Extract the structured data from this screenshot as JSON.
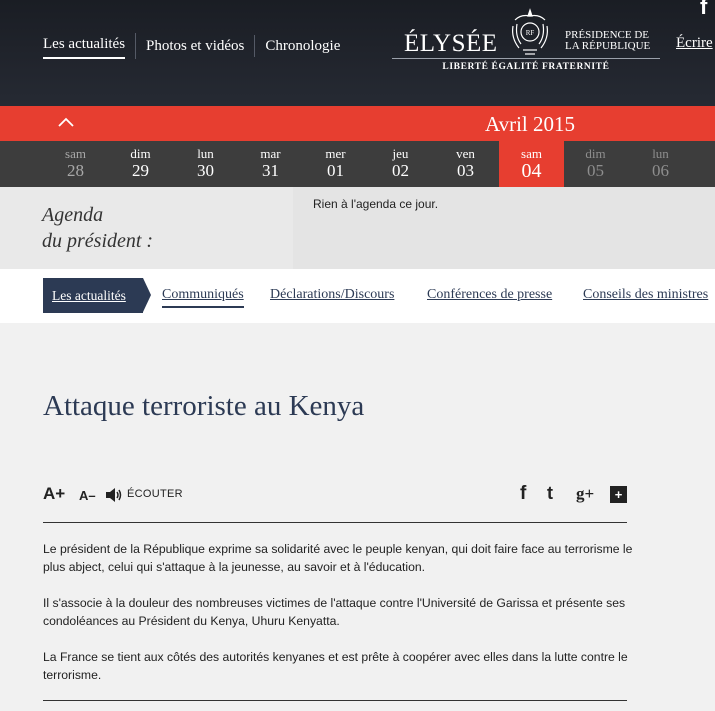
{
  "header": {
    "nav": [
      "Les actualités",
      "Photos et vidéos",
      "Chronologie"
    ],
    "active_nav": "Les actualités",
    "logo_name": "ÉLYSÉE",
    "logo_presidence_line1": "PRÉSIDENCE DE",
    "logo_presidence_line2": "LA RÉPUBLIQUE",
    "logo_motto": "LIBERTÉ ÉGALITÉ FRATERNITÉ",
    "ecrire": "Écrire",
    "facebook_glyph": "f"
  },
  "calendar": {
    "month": "Avril 2015",
    "days": [
      {
        "name": "sam",
        "num": "28"
      },
      {
        "name": "dim",
        "num": "29"
      },
      {
        "name": "lun",
        "num": "30"
      },
      {
        "name": "mar",
        "num": "31"
      },
      {
        "name": "mer",
        "num": "01"
      },
      {
        "name": "jeu",
        "num": "02"
      },
      {
        "name": "ven",
        "num": "03"
      },
      {
        "name": "sam",
        "num": "04"
      },
      {
        "name": "dim",
        "num": "05"
      },
      {
        "name": "lun",
        "num": "06"
      }
    ]
  },
  "agenda": {
    "title_line1": "Agenda",
    "title_line2": "du président :",
    "empty_text": "Rien à l'agenda ce jour."
  },
  "subnav": {
    "active": "Les actualités",
    "links": [
      "Communiqués",
      "Déclarations/Discours",
      "Conférences de presse",
      "Conseils des ministres"
    ]
  },
  "article": {
    "title": "Attaque terroriste au Kenya",
    "tools": {
      "aplus": "A+",
      "aminus": "A–",
      "listen": "ÉCOUTER"
    },
    "social": {
      "facebook": "f",
      "twitter": "t",
      "googleplus": "g+",
      "more": "+"
    },
    "paragraphs": [
      "Le président de la République exprime sa solidarité avec le peuple kenyan, qui doit faire face au terrorisme le plus abject, celui qui s'attaque à la jeunesse, au savoir et à l'éducation.",
      "Il s'associe à la douleur des nombreuses victimes de l'attaque contre l'Université de Garissa et présente ses condoléances au Président du Kenya, Uhuru Kenyatta.",
      "La France se tient aux côtés des autorités kenyanes et est prête à coopérer avec elles dans la lutte contre le terrorisme."
    ]
  },
  "colors": {
    "header_bg": "#1f232b",
    "accent_red": "#e73e30",
    "navy": "#2c3a54",
    "days_bg": "#3d3d3d"
  }
}
